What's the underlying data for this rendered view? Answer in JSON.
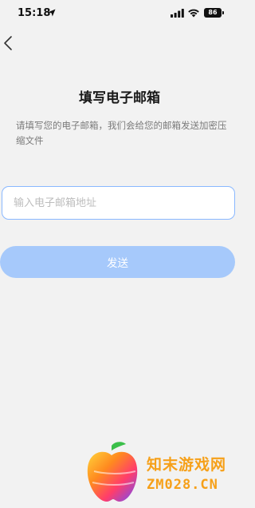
{
  "status_bar": {
    "time": "15:18",
    "battery": "86",
    "icons": [
      "location-arrow-icon",
      "cellular-signal-icon",
      "wifi-icon",
      "battery-icon"
    ]
  },
  "nav": {
    "back_icon": "chevron-left-icon"
  },
  "page": {
    "title": "填写电子邮箱",
    "subtitle": "请填写您的电子邮箱，我们会给您的邮箱发送加密压缩文件"
  },
  "form": {
    "email_value": "",
    "email_placeholder": "输入电子邮箱地址",
    "send_label": "发送"
  },
  "colors": {
    "background": "#f2f2f2",
    "input_border": "#8ab8ff",
    "button_disabled": "#a6c9fb",
    "watermark": "#f6a019"
  },
  "watermark": {
    "text_cn": "知末游戏网",
    "text_en": "ZM028.CN"
  }
}
